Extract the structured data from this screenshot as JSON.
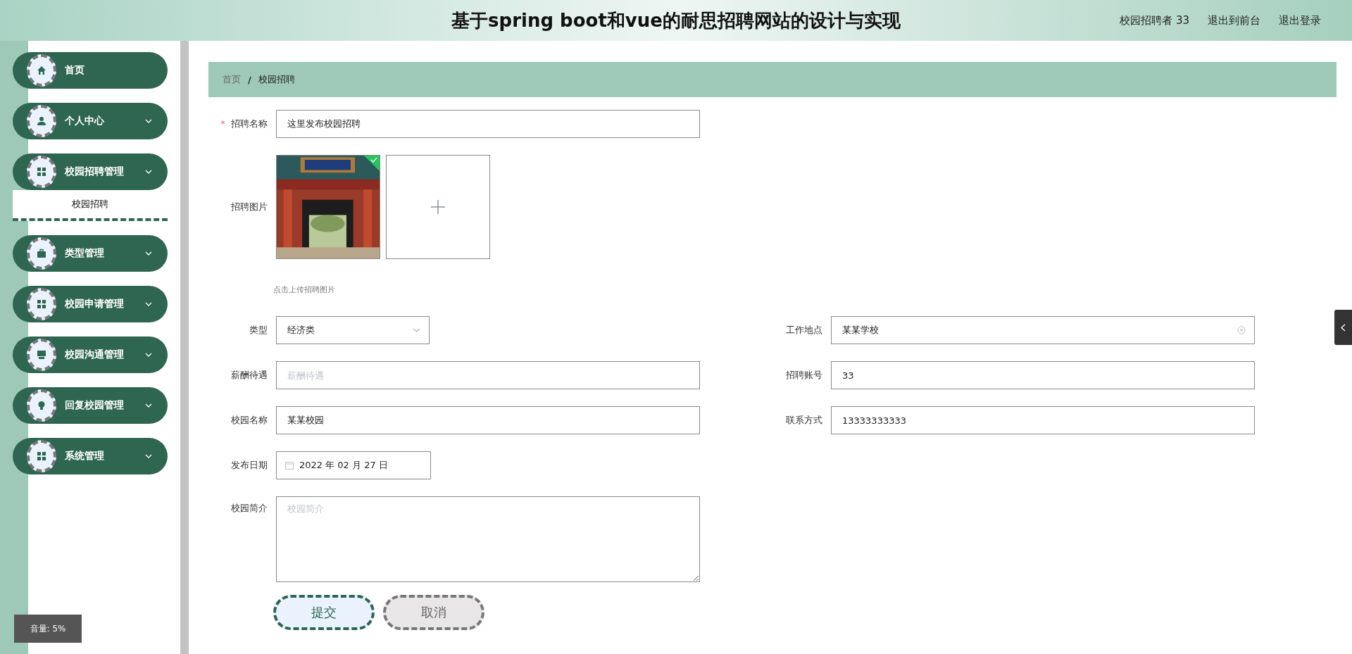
{
  "header": {
    "title": "基于spring boot和vue的耐思招聘网站的设计与实现",
    "user": "校园招聘者 33",
    "links": [
      "退出到前台",
      "退出登录"
    ]
  },
  "sidebar": {
    "items": [
      {
        "label": "首页",
        "kind": "link"
      },
      {
        "label": "个人中心",
        "kind": "group"
      },
      {
        "label": "校园招聘管理",
        "kind": "group",
        "children": [
          {
            "label": "校园招聘",
            "selected": true
          }
        ]
      },
      {
        "label": "类型管理",
        "kind": "group"
      },
      {
        "label": "校园申请管理",
        "kind": "group"
      },
      {
        "label": "校园沟通管理",
        "kind": "group"
      },
      {
        "label": "回复校园管理",
        "kind": "group"
      },
      {
        "label": "系统管理",
        "kind": "group"
      }
    ]
  },
  "breadcrumb": {
    "items": [
      "首页",
      "校园招聘"
    ],
    "separator": "/"
  },
  "form": {
    "name": {
      "label": "招聘名称",
      "required_mark": "*",
      "value": "这里发布校园招聘"
    },
    "image": {
      "label": "招聘图片",
      "uploaded": true,
      "hint": "点击上传招聘图片"
    },
    "left": [
      {
        "kind": "select",
        "label": "类型",
        "value": "经济类"
      },
      {
        "kind": "input",
        "label": "薪酬待遇",
        "placeholder": "薪酬待遇"
      },
      {
        "kind": "input",
        "label": "校园名称",
        "value": "某某校园"
      },
      {
        "kind": "date",
        "label": "发布日期",
        "value": "2022 年 02 月 27 日"
      }
    ],
    "right": [
      {
        "kind": "input",
        "label": "工作地点",
        "value": "某某学校",
        "clearable": true
      },
      {
        "kind": "input",
        "label": "招聘账号",
        "value": "33"
      },
      {
        "kind": "input",
        "label": "联系方式",
        "value": "13333333333"
      }
    ],
    "intro": {
      "label": "校园简介",
      "placeholder": "校园简介"
    },
    "buttons": [
      {
        "label": "提交",
        "kind": "primary"
      },
      {
        "label": "取消",
        "kind": "cancel"
      }
    ]
  },
  "volume_toast": "音量: 5%"
}
